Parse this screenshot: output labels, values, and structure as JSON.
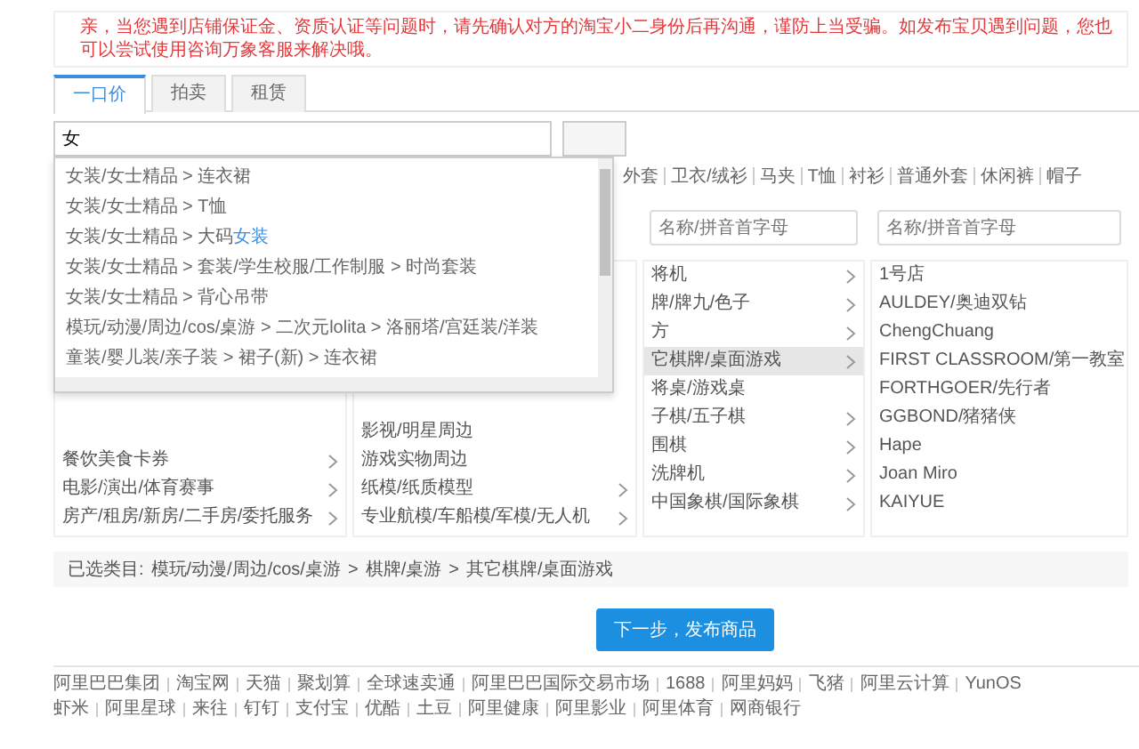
{
  "notice": "亲，当您遇到店铺保证金、资质认证等问题时，请先确认对方的淘宝小二身份后再沟通，谨防上当受骗。如发布宝贝遇到问题，您也可以尝试使用咨询万象客服来解决哦。",
  "tabs": [
    {
      "label": "一口价",
      "selected": true
    },
    {
      "label": "拍卖",
      "selected": false
    },
    {
      "label": "租赁",
      "selected": false
    }
  ],
  "search": {
    "value": "女"
  },
  "suggestions": [
    {
      "text": "女装/女士精品 > 连衣裙"
    },
    {
      "text": "女装/女士精品 > T恤"
    },
    {
      "text": "女装/女士精品 > 大码",
      "match": "女装"
    },
    {
      "text": "女装/女士精品 > 套装/学生校服/工作制服 > 时尚套装"
    },
    {
      "text": "女装/女士精品 > 背心吊带"
    },
    {
      "text": "模玩/动漫/周边/cos/桌游 > 二次元lolita > 洛丽塔/宫廷装/洋装"
    },
    {
      "text": "童装/婴儿装/亲子装 > 裙子(新) > 连衣裙"
    }
  ],
  "hot_tags": [
    "外套",
    "卫衣/绒衫",
    "马夹",
    "T恤",
    "衬衫",
    "普通外套",
    "休闲裤",
    "帽子"
  ],
  "columns": [
    {
      "items": [
        {
          "label": "餐饮美食卡券",
          "has_children": true,
          "selected": false
        },
        {
          "label": "电影/演出/体育赛事",
          "has_children": true,
          "selected": false
        },
        {
          "label": "房产/租房/新房/二手房/委托服务",
          "has_children": true,
          "selected": false
        }
      ]
    },
    {
      "items": [
        {
          "label": "影视/明星周边",
          "has_children": false,
          "selected": false
        },
        {
          "label": "游戏实物周边",
          "has_children": false,
          "selected": false
        },
        {
          "label": "纸模/纸质模型",
          "has_children": true,
          "selected": false
        },
        {
          "label": "专业航模/车船模/军模/无人机",
          "has_children": true,
          "selected": false
        }
      ]
    },
    {
      "placeholder": "名称/拼音首字母",
      "items": [
        {
          "label": "将机",
          "has_children": true,
          "selected": false
        },
        {
          "label": "牌/牌九/色子",
          "has_children": true,
          "selected": false
        },
        {
          "label": "方",
          "has_children": true,
          "selected": false
        },
        {
          "label": "它棋牌/桌面游戏",
          "has_children": true,
          "selected": true
        },
        {
          "label": "将桌/游戏桌",
          "has_children": false,
          "selected": false
        },
        {
          "label": "子棋/五子棋",
          "has_children": true,
          "selected": false
        },
        {
          "label": "围棋",
          "has_children": true,
          "selected": false
        },
        {
          "label": "洗牌机",
          "has_children": true,
          "selected": false
        },
        {
          "label": "中国象棋/国际象棋",
          "has_children": true,
          "selected": false
        }
      ]
    },
    {
      "placeholder": "名称/拼音首字母",
      "items": [
        {
          "label": "1号店",
          "has_children": false,
          "selected": false
        },
        {
          "label": "AULDEY/奥迪双钻",
          "has_children": false,
          "selected": false
        },
        {
          "label": "ChengChuang",
          "has_children": false,
          "selected": false
        },
        {
          "label": "FIRST CLASSROOM/第一教室",
          "has_children": false,
          "selected": false
        },
        {
          "label": "FORTHGOER/先行者",
          "has_children": false,
          "selected": false
        },
        {
          "label": "GGBOND/猪猪侠",
          "has_children": false,
          "selected": false
        },
        {
          "label": "Hape",
          "has_children": false,
          "selected": false
        },
        {
          "label": "Joan Miro",
          "has_children": false,
          "selected": false
        },
        {
          "label": "KAIYUE",
          "has_children": false,
          "selected": false
        }
      ]
    }
  ],
  "selected_path": {
    "label": "已选类目:",
    "parts": [
      "模玩/动漫/周边/cos/桌游",
      "棋牌/桌游",
      "其它棋牌/桌面游戏"
    ],
    "separator": ">"
  },
  "next_button": "下一步，发布商品",
  "footer_links": [
    [
      "阿里巴巴集团",
      "淘宝网",
      "天猫",
      "聚划算",
      "全球速卖通",
      "阿里巴巴国际交易市场",
      "1688",
      "阿里妈妈",
      "飞猪",
      "阿里云计算",
      "YunOS"
    ],
    [
      "虾米",
      "阿里星球",
      "来往",
      "钉钉",
      "支付宝",
      "优酷",
      "土豆",
      "阿里健康",
      "阿里影业",
      "阿里体育",
      "网商银行"
    ]
  ]
}
